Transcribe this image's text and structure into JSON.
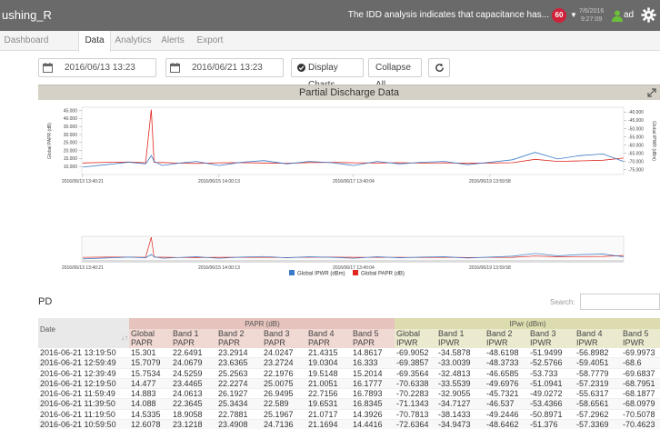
{
  "app": {
    "title": "ushing_R",
    "message": "The IDD analysis indicates that capacitance has...",
    "notification_count": "60",
    "date_line1": "7/6/2016",
    "date_line2": "9:27:09",
    "user": "ad"
  },
  "tabs": [
    {
      "label": "Dashboard",
      "active": false
    },
    {
      "label": "Data",
      "active": true
    },
    {
      "label": "Analytics",
      "active": false
    },
    {
      "label": "Alerts",
      "active": false
    },
    {
      "label": "Export",
      "active": false
    }
  ],
  "filters": {
    "start_date": "2016/06/13 13:23",
    "end_date": "2016/06/21 13:23",
    "display_charts": "Display Charts",
    "collapse_all": "Collapse All"
  },
  "chart_panel": {
    "title": "Partial Discharge Data"
  },
  "chart_data": {
    "type": "line",
    "title": "Partial Discharge Data",
    "ylabel_left": "Global PAPR (dB)",
    "ylabel_right": "Global IPWR (dBm)",
    "y_left_ticks": [
      "45.000",
      "40.000",
      "35.000",
      "30.000",
      "25.000",
      "20.000",
      "15.000",
      "10.000"
    ],
    "y_right_ticks": [
      "-40.000",
      "-45.000",
      "-50.000",
      "-55.000",
      "-60.000",
      "-65.000",
      "-70.000",
      "-75.000"
    ],
    "y_left_range": [
      5,
      47
    ],
    "y_right_range": [
      -78,
      -37
    ],
    "x_ticks": [
      "2016/06/13 13:40:21",
      "2016/06/15 14:00:13",
      "2016/06/17 13:40:04",
      "2016/06/19 13:59:58"
    ],
    "navigator_x_ticks": [
      "2016/06/13 13:40:21",
      "2016/06/15 14:00:13",
      "2016/06/17 13:40:04",
      "2016/06/19 13:59:58"
    ],
    "x_range": [
      "2016/06/13 13:23",
      "2016/06/21 13:23"
    ],
    "legend": [
      {
        "name": "Global IPWR (dBm)",
        "color": "#3a7bc8"
      },
      {
        "name": "Global PAPR (dB)",
        "color": "#e0261e"
      }
    ],
    "legend_position": "bottom",
    "series": [
      {
        "name": "Global PAPR (dB)",
        "axis": "left",
        "color": "#e0261e",
        "x": [
          "2016/06/13 13:40",
          "2016/06/13 22:00",
          "2016/06/14 06:00",
          "2016/06/14 12:00",
          "2016/06/14 14:00",
          "2016/06/14 15:00",
          "2016/06/14 18:00",
          "2016/06/15 00:00",
          "2016/06/15 06:00",
          "2016/06/15 14:00",
          "2016/06/15 22:00",
          "2016/06/16 06:00",
          "2016/06/16 14:00",
          "2016/06/16 22:00",
          "2016/06/17 06:00",
          "2016/06/17 13:40",
          "2016/06/17 22:00",
          "2016/06/18 06:00",
          "2016/06/18 14:00",
          "2016/06/18 22:00",
          "2016/06/19 06:00",
          "2016/06/19 14:00",
          "2016/06/19 22:00",
          "2016/06/20 06:00",
          "2016/06/20 14:00",
          "2016/06/20 22:00",
          "2016/06/21 06:00",
          "2016/06/21 13:19"
        ],
        "y": [
          12.2,
          12.6,
          12.8,
          12.4,
          45.5,
          12.6,
          12.5,
          12.1,
          11.9,
          12.3,
          12.4,
          12.2,
          12.0,
          12.5,
          12.6,
          12.3,
          12.2,
          12.4,
          12.1,
          12.3,
          12.0,
          12.2,
          12.4,
          14.5,
          13.2,
          13.5,
          13.9,
          15.3
        ]
      },
      {
        "name": "Global IPWR (dBm)",
        "axis": "right",
        "color": "#3a7bc8",
        "x": [
          "2016/06/13 13:40",
          "2016/06/13 22:00",
          "2016/06/14 06:00",
          "2016/06/14 12:00",
          "2016/06/14 14:00",
          "2016/06/14 15:00",
          "2016/06/14 18:00",
          "2016/06/15 00:00",
          "2016/06/15 06:00",
          "2016/06/15 14:00",
          "2016/06/15 22:00",
          "2016/06/16 06:00",
          "2016/06/16 14:00",
          "2016/06/16 22:00",
          "2016/06/17 06:00",
          "2016/06/17 13:40",
          "2016/06/17 22:00",
          "2016/06/18 06:00",
          "2016/06/18 14:00",
          "2016/06/18 22:00",
          "2016/06/19 06:00",
          "2016/06/19 14:00",
          "2016/06/19 22:00",
          "2016/06/20 06:00",
          "2016/06/20 14:00",
          "2016/06/20 22:00",
          "2016/06/21 06:00",
          "2016/06/21 13:19"
        ],
        "y": [
          -73.5,
          -72.0,
          -70.5,
          -71.5,
          -66.5,
          -70.0,
          -72.5,
          -71.0,
          -70.0,
          -72.5,
          -70.5,
          -69.5,
          -71.5,
          -70.0,
          -70.8,
          -72.5,
          -70.0,
          -71.5,
          -70.5,
          -70.0,
          -72.0,
          -70.5,
          -69.0,
          -64.5,
          -68.5,
          -66.5,
          -65.5,
          -70.0
        ]
      }
    ]
  },
  "pd_table": {
    "title": "PD",
    "search_label": "Search:",
    "group_headers": {
      "date": "",
      "papr": "PAPR (dB)",
      "ipwr": "IPwr (dBm)"
    },
    "columns": [
      "Date",
      "Global PAPR",
      "Band 1 PAPR",
      "Band 2 PAPR",
      "Band 3 PAPR",
      "Band 4 PAPR",
      "Band 5 PAPR",
      "Global IPWR",
      "Band 1 IPWR",
      "Band 2 IPWR",
      "Band 3 IPWR",
      "Band 4 IPWR",
      "Band 5 IPWR"
    ],
    "rows": [
      [
        "2016-06-21 13:19:50",
        "15.301",
        "22.6491",
        "23.2914",
        "24.0247",
        "21.4315",
        "14.8617",
        "-69.9052",
        "-34.5878",
        "-48.6198",
        "-51.9499",
        "-56.8982",
        "-69.9973"
      ],
      [
        "2016-06-21 12:59:49",
        "15.7079",
        "24.0679",
        "23.6365",
        "23.2724",
        "19.0304",
        "16.333",
        "-69.3857",
        "-33.0039",
        "-48.3733",
        "-52.5766",
        "-59.4051",
        "-68.6"
      ],
      [
        "2016-06-21 12:39:49",
        "15.7534",
        "24.5259",
        "25.2563",
        "22.1976",
        "19.5148",
        "15.2014",
        "-69.3564",
        "-32.4813",
        "-46.6585",
        "-53.733",
        "-58.7779",
        "-69.6837"
      ],
      [
        "2016-06-21 12:19:50",
        "14.477",
        "23.4465",
        "22.2274",
        "25.0075",
        "21.0051",
        "16.1777",
        "-70.6338",
        "-33.5539",
        "-49.6976",
        "-51.0941",
        "-57.2319",
        "-68.7951"
      ],
      [
        "2016-06-21 11:59:49",
        "14.883",
        "24.0613",
        "26.1927",
        "26.9495",
        "22.7156",
        "16.7893",
        "-70.2283",
        "-32.9055",
        "-45.7321",
        "-49.0272",
        "-55.6317",
        "-68.1877"
      ],
      [
        "2016-06-21 11:39:50",
        "14.088",
        "22.3645",
        "25.3434",
        "22.589",
        "19.6531",
        "16.8345",
        "-71.1343",
        "-34.7127",
        "-46.537",
        "-53.4366",
        "-58.6561",
        "-68.0979"
      ],
      [
        "2016-06-21 11:19:50",
        "14.5335",
        "18.9058",
        "22.7881",
        "25.1967",
        "21.0717",
        "14.3926",
        "-70.7813",
        "-38.1433",
        "-49.2446",
        "-50.8971",
        "-57.2962",
        "-70.5078"
      ],
      [
        "2016-06-21 10:59:50",
        "12.6078",
        "23.1218",
        "23.4908",
        "24.7136",
        "21.1694",
        "14.4416",
        "-72.6364",
        "-34.9473",
        "-48.6462",
        "-51.376",
        "-57.3369",
        "-70.4623"
      ]
    ]
  }
}
